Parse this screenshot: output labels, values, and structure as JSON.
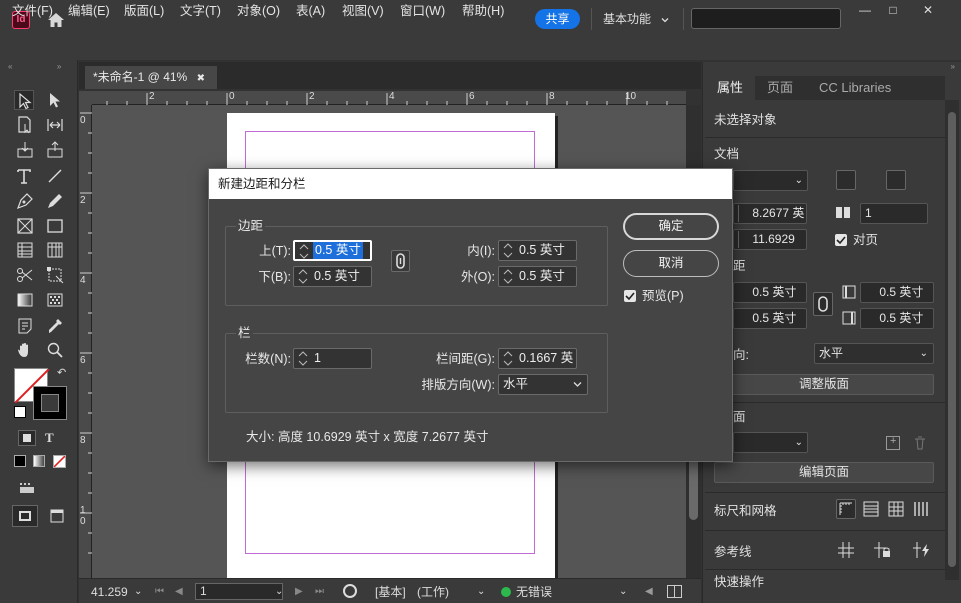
{
  "app": {
    "logo_text": "Id",
    "share_label": "共享",
    "workspace_label": "基本功能",
    "window_controls": [
      "—",
      "□",
      "✕"
    ]
  },
  "menu": [
    "文件(F)",
    "编辑(E)",
    "版面(L)",
    "文字(T)",
    "对象(O)",
    "表(A)",
    "视图(V)",
    "窗口(W)",
    "帮助(H)"
  ],
  "document": {
    "tab_title": "*未命名-1 @ 41%",
    "tab_close": "✖",
    "ruler_h_ticks": [
      "2",
      "0",
      "2",
      "4",
      "6",
      "8",
      "10"
    ],
    "ruler_v_ticks": [
      "0",
      "2",
      "4",
      "6",
      "8",
      "1 0"
    ]
  },
  "status": {
    "zoom": "41.259",
    "page_number": "1",
    "master": "[基本]",
    "mode": "(工作)",
    "preflight": "无错误"
  },
  "right_panel": {
    "tabs": [
      "属性",
      "页面",
      "CC Libraries"
    ],
    "no_selection": "未选择对象",
    "section_document": "文档",
    "width_value": "8.2677 英",
    "height_value": "11.6929",
    "pages_value": "1",
    "facing_pages_label": "对页",
    "section_margins_partial": "距",
    "margin_top": "0.5 英寸",
    "margin_bottom": "0.5 英寸",
    "margin_inside": "0.5 英寸",
    "margin_outside": "0.5 英寸",
    "direction_label_partial": "向:",
    "direction_value": "水平",
    "adjust_layout_button": "调整版面",
    "section_page_partial": "面",
    "edit_page_button": "编辑页面",
    "section_rulers": "标尺和网格",
    "section_guides": "参考线",
    "section_quick_actions": "快速操作"
  },
  "dialog": {
    "title": "新建边距和分栏",
    "margins_group": "边距",
    "top_label": "上(T):",
    "top_value": "0.5 英寸",
    "bottom_label": "下(B):",
    "bottom_value": "0.5 英寸",
    "inside_label": "内(I):",
    "inside_value": "0.5 英寸",
    "outside_label": "外(O):",
    "outside_value": "0.5 英寸",
    "columns_group": "栏",
    "columns_count_label": "栏数(N):",
    "columns_count_value": "1",
    "gutter_label": "栏间距(G):",
    "gutter_value": "0.1667 英",
    "direction_label": "排版方向(W):",
    "direction_value": "水平",
    "ok_button": "确定",
    "cancel_button": "取消",
    "preview_label": "预览(P)",
    "size_text": "大小: 高度 10.6929 英寸 x 宽度 7.2677 英寸"
  },
  "colors": {
    "accent": "#1473e6",
    "margin_guide": "#c26bd6",
    "status_ok": "#2db84d"
  }
}
